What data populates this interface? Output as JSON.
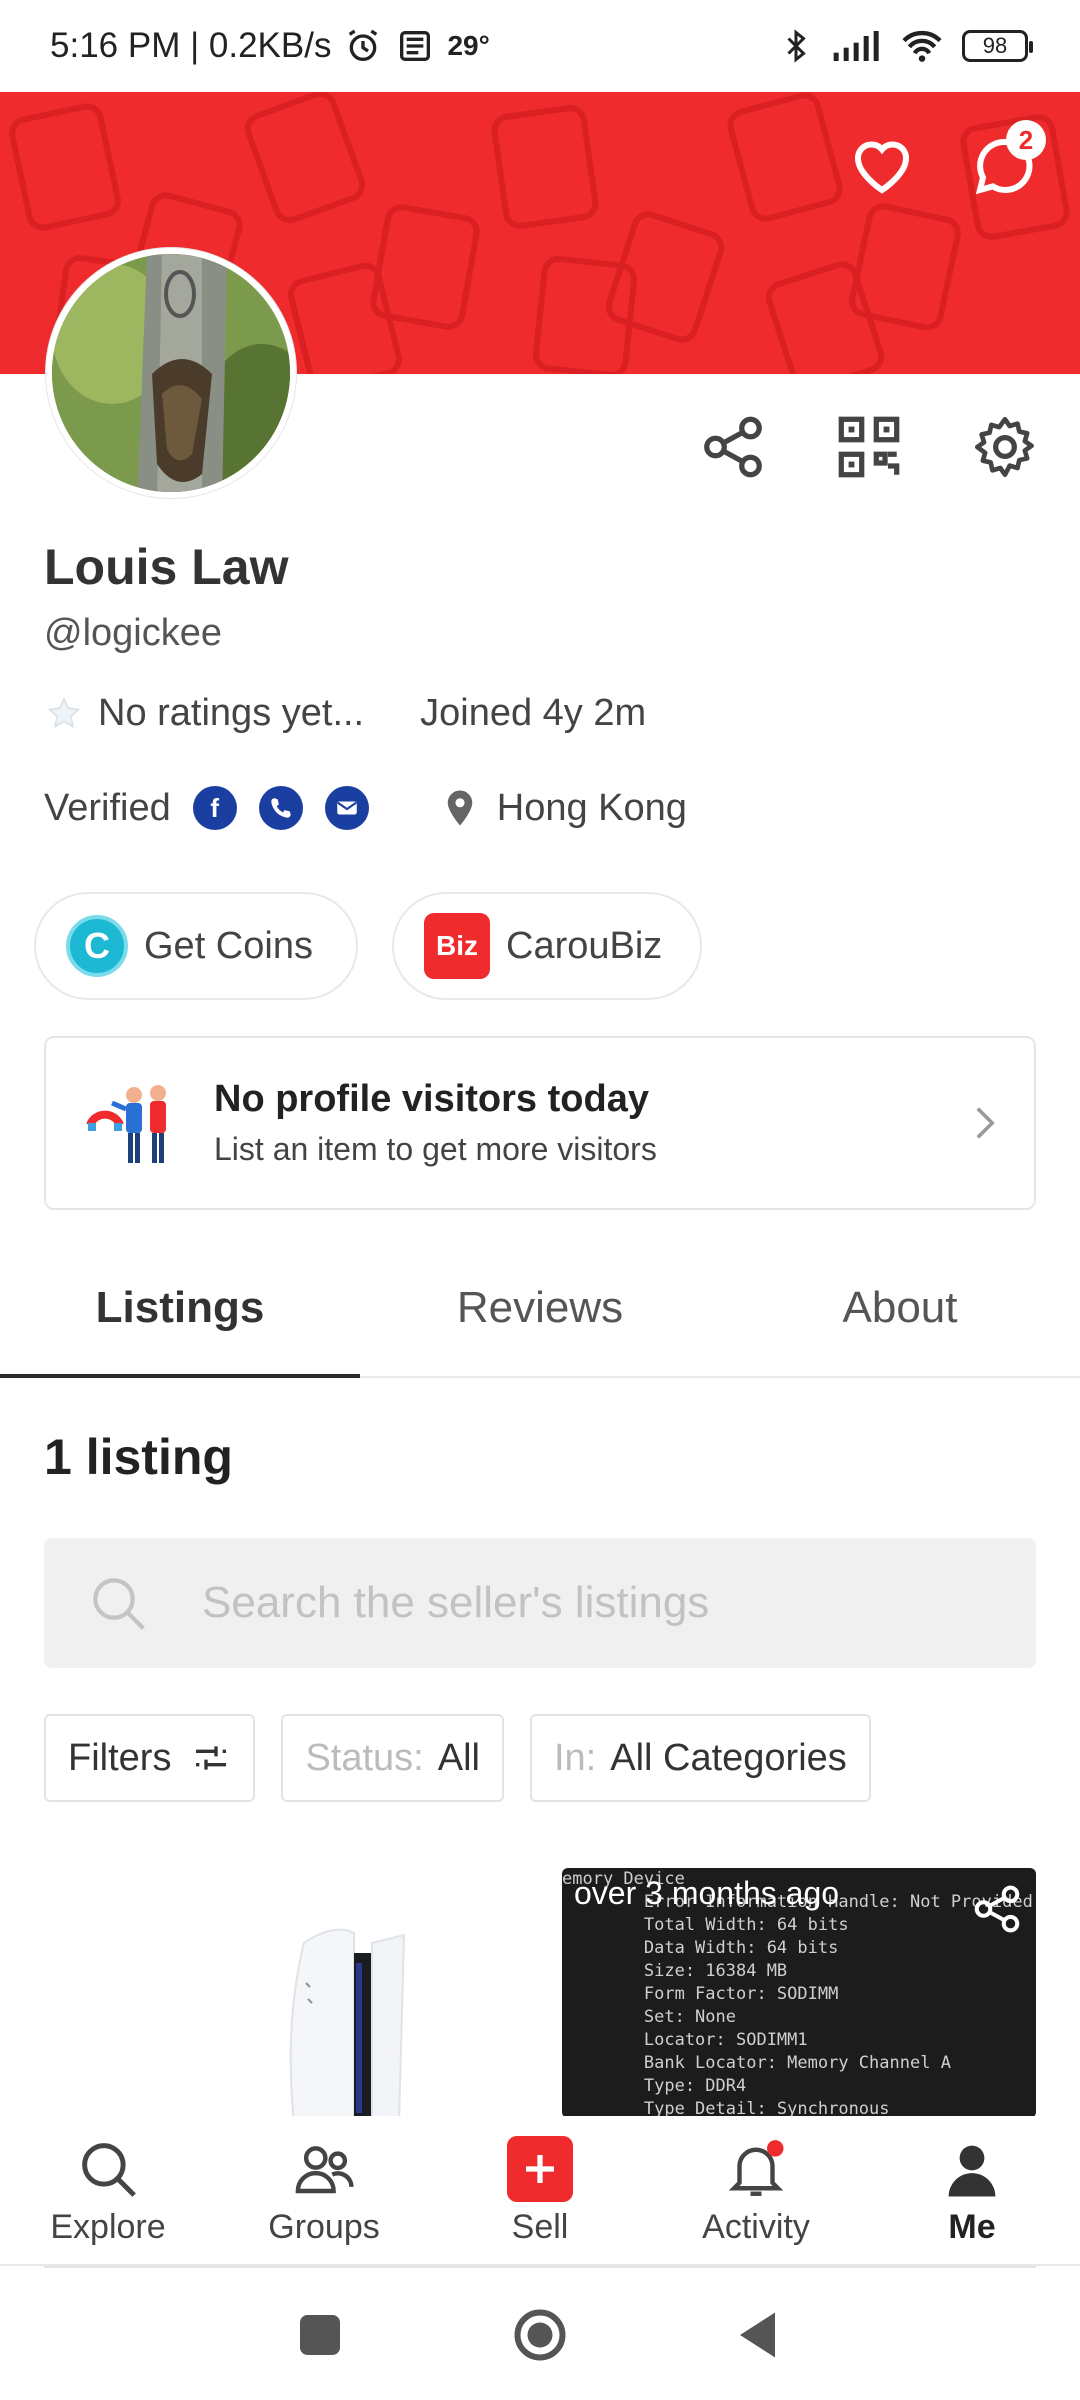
{
  "status_bar": {
    "time_speed": "5:16 PM | 0.2KB/s",
    "temperature": "29°",
    "battery": "98"
  },
  "header": {
    "favorites_icon": "heart-icon",
    "chat_icon": "chat-icon",
    "chat_badge": "2"
  },
  "actions": {
    "share_icon": "share-icon",
    "qr_icon": "qr-code-icon",
    "settings_icon": "gear-icon"
  },
  "profile": {
    "name": "Louis Law",
    "handle": "@logickee",
    "ratings": "No ratings yet...",
    "joined": "Joined 4y 2m",
    "verified_label": "Verified",
    "verified_methods": [
      "facebook",
      "phone",
      "email"
    ],
    "location": "Hong Kong"
  },
  "chips": {
    "coins_label": "Get Coins",
    "coins_logo": "C",
    "biz_label": "CarouBiz",
    "biz_logo": "Biz"
  },
  "visitors": {
    "title": "No profile visitors today",
    "subtitle": "List an item to get more visitors"
  },
  "tabs": [
    {
      "label": "Listings",
      "active": true
    },
    {
      "label": "Reviews",
      "active": false
    },
    {
      "label": "About",
      "active": false
    }
  ],
  "listings": {
    "count_label": "1 listing",
    "search_placeholder": "Search the seller's listings",
    "filters_label": "Filters",
    "status_label": "Status:",
    "status_value": "All",
    "in_label": "In:",
    "in_value": "All Categories"
  },
  "cards": [
    {
      "image": "ps5-console"
    },
    {
      "time": "over 3 months ago",
      "screen_lines": [
        "emory Device",
        "        Error Information Handle: Not Provided",
        "        Total Width: 64 bits",
        "        Data Width: 64 bits",
        "        Size: 16384 MB",
        "        Form Factor: SODIMM",
        "        Set: None",
        "        Locator: SODIMM1",
        "        Bank Locator: Memory Channel A",
        "        Type: DDR4",
        "        Type Detail: Synchronous"
      ]
    }
  ],
  "bottom_nav": [
    {
      "label": "Explore",
      "icon": "search-icon"
    },
    {
      "label": "Groups",
      "icon": "groups-icon"
    },
    {
      "label": "Sell",
      "icon": "plus-icon"
    },
    {
      "label": "Activity",
      "icon": "bell-icon"
    },
    {
      "label": "Me",
      "icon": "person-icon",
      "active": true
    }
  ],
  "colors": {
    "brand_red": "#ef2b2d",
    "verified_blue": "#1a3fa0"
  }
}
